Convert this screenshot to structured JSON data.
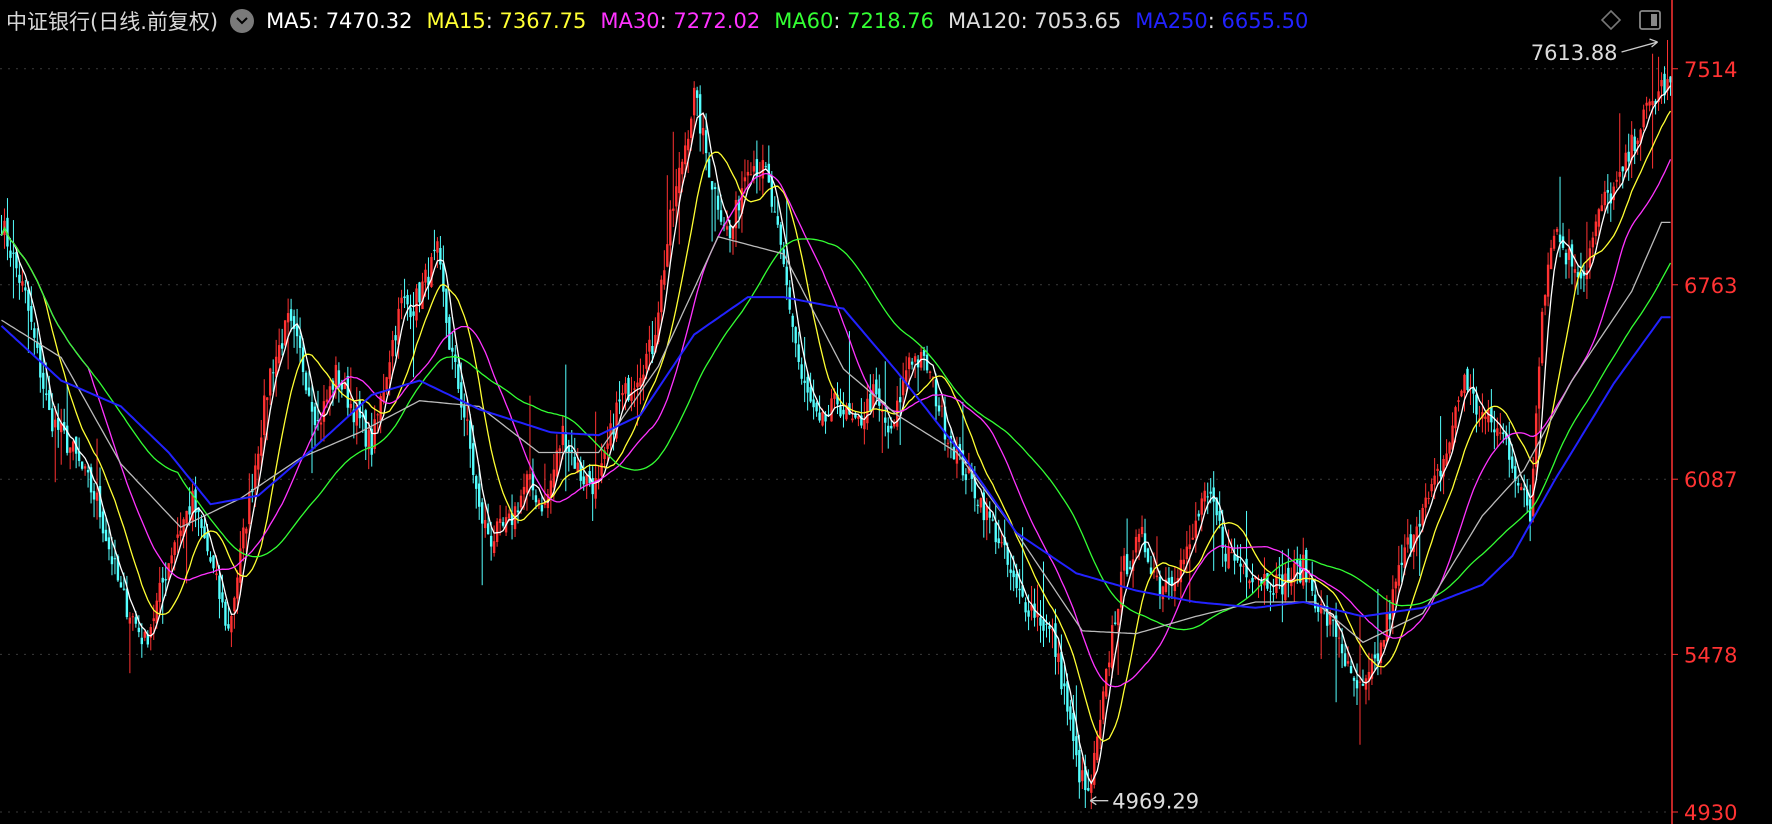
{
  "header": {
    "title": "中证银行(日线.前复权)",
    "dropdown_icon": "chevron-down-icon",
    "indicators": [
      {
        "label": "MA5",
        "value": "7470.32",
        "color": "#ffffff"
      },
      {
        "label": "MA15",
        "value": "7367.75",
        "color": "#ffff33"
      },
      {
        "label": "MA30",
        "value": "7272.02",
        "color": "#ff33ff"
      },
      {
        "label": "MA60",
        "value": "7218.76",
        "color": "#33ff33"
      },
      {
        "label": "MA120",
        "value": "7053.65",
        "color": "#dddddd"
      },
      {
        "label": "MA250",
        "value": "6655.50",
        "color": "#2222ff"
      }
    ],
    "icons": [
      "diamond-icon",
      "panel-toggle-icon"
    ]
  },
  "chart_data": {
    "type": "candlestick",
    "y_axis": {
      "ticks": [
        "7514",
        "6763",
        "6087",
        "5478",
        "4930"
      ],
      "ylim": [
        4930,
        7614
      ],
      "side": "right",
      "color": "#ff3333"
    },
    "grid": true,
    "annotations": [
      {
        "text": "7613.88",
        "kind": "high"
      },
      {
        "text": "4969.29",
        "kind": "low"
      }
    ],
    "close_path": [
      [
        0,
        6980
      ],
      [
        8,
        6720
      ],
      [
        16,
        6310
      ],
      [
        24,
        6180
      ],
      [
        32,
        6010
      ],
      [
        40,
        5690
      ],
      [
        48,
        5520
      ],
      [
        52,
        5650
      ],
      [
        58,
        5880
      ],
      [
        64,
        6010
      ],
      [
        70,
        5800
      ],
      [
        76,
        5560
      ],
      [
        84,
        6080
      ],
      [
        90,
        6460
      ],
      [
        96,
        6630
      ],
      [
        100,
        6520
      ],
      [
        106,
        6280
      ],
      [
        112,
        6450
      ],
      [
        118,
        6330
      ],
      [
        124,
        6200
      ],
      [
        130,
        6520
      ],
      [
        134,
        6700
      ],
      [
        138,
        6690
      ],
      [
        146,
        6870
      ],
      [
        150,
        6560
      ],
      [
        156,
        6260
      ],
      [
        160,
        5970
      ],
      [
        164,
        5880
      ],
      [
        170,
        5930
      ],
      [
        176,
        6080
      ],
      [
        182,
        5990
      ],
      [
        188,
        6250
      ],
      [
        194,
        6100
      ],
      [
        200,
        6060
      ],
      [
        206,
        6330
      ],
      [
        212,
        6440
      ],
      [
        218,
        6550
      ],
      [
        224,
        6980
      ],
      [
        232,
        7420
      ],
      [
        238,
        7120
      ],
      [
        244,
        6920
      ],
      [
        250,
        7200
      ],
      [
        256,
        7150
      ],
      [
        262,
        6820
      ],
      [
        268,
        6430
      ],
      [
        274,
        6260
      ],
      [
        280,
        6360
      ],
      [
        286,
        6260
      ],
      [
        292,
        6380
      ],
      [
        298,
        6230
      ],
      [
        304,
        6520
      ],
      [
        310,
        6480
      ],
      [
        316,
        6270
      ],
      [
        322,
        6130
      ],
      [
        328,
        6010
      ],
      [
        334,
        5880
      ],
      [
        340,
        5690
      ],
      [
        346,
        5630
      ],
      [
        352,
        5540
      ],
      [
        356,
        5350
      ],
      [
        360,
        5100
      ],
      [
        364,
        4975
      ],
      [
        368,
        5230
      ],
      [
        372,
        5560
      ],
      [
        376,
        5780
      ],
      [
        382,
        5880
      ],
      [
        388,
        5720
      ],
      [
        394,
        5780
      ],
      [
        398,
        5840
      ],
      [
        402,
        6010
      ],
      [
        406,
        5990
      ],
      [
        410,
        5840
      ],
      [
        414,
        5800
      ],
      [
        420,
        5760
      ],
      [
        428,
        5720
      ],
      [
        436,
        5780
      ],
      [
        442,
        5630
      ],
      [
        448,
        5540
      ],
      [
        452,
        5380
      ],
      [
        456,
        5340
      ],
      [
        462,
        5500
      ],
      [
        468,
        5760
      ],
      [
        474,
        5950
      ],
      [
        478,
        6010
      ],
      [
        484,
        6180
      ],
      [
        490,
        6450
      ],
      [
        494,
        6330
      ],
      [
        498,
        6290
      ],
      [
        504,
        6220
      ],
      [
        508,
        6080
      ],
      [
        512,
        5950
      ],
      [
        516,
        6700
      ],
      [
        520,
        6970
      ],
      [
        524,
        6870
      ],
      [
        530,
        6800
      ],
      [
        536,
        7040
      ],
      [
        542,
        7120
      ],
      [
        548,
        7300
      ],
      [
        552,
        7380
      ],
      [
        556,
        7450
      ]
    ],
    "series": [
      {
        "name": "MA5",
        "color": "#ffffff",
        "period": 5
      },
      {
        "name": "MA15",
        "color": "#ffff33",
        "period": 15
      },
      {
        "name": "MA30",
        "color": "#ff33ff",
        "period": 30
      },
      {
        "name": "MA60",
        "color": "#33ff33",
        "period": 60
      },
      {
        "name": "MA120",
        "color": "#bbbbbb",
        "period": 120
      },
      {
        "name": "MA250",
        "color": "#2222ff",
        "period": 250
      }
    ],
    "ma250_path": [
      [
        0,
        6620
      ],
      [
        20,
        6430
      ],
      [
        40,
        6340
      ],
      [
        56,
        6180
      ],
      [
        70,
        6000
      ],
      [
        86,
        6030
      ],
      [
        104,
        6190
      ],
      [
        124,
        6380
      ],
      [
        140,
        6430
      ],
      [
        160,
        6330
      ],
      [
        184,
        6250
      ],
      [
        200,
        6240
      ],
      [
        214,
        6310
      ],
      [
        232,
        6590
      ],
      [
        250,
        6720
      ],
      [
        262,
        6720
      ],
      [
        282,
        6680
      ],
      [
        300,
        6460
      ],
      [
        322,
        6170
      ],
      [
        340,
        5900
      ],
      [
        360,
        5760
      ],
      [
        380,
        5700
      ],
      [
        400,
        5660
      ],
      [
        420,
        5640
      ],
      [
        436,
        5660
      ],
      [
        456,
        5610
      ],
      [
        476,
        5640
      ],
      [
        496,
        5720
      ],
      [
        506,
        5820
      ],
      [
        520,
        6080
      ],
      [
        540,
        6420
      ],
      [
        556,
        6650
      ]
    ],
    "ma120_path": [
      [
        0,
        6640
      ],
      [
        20,
        6510
      ],
      [
        40,
        6140
      ],
      [
        60,
        5920
      ],
      [
        80,
        6020
      ],
      [
        100,
        6160
      ],
      [
        120,
        6250
      ],
      [
        140,
        6360
      ],
      [
        160,
        6340
      ],
      [
        180,
        6180
      ],
      [
        200,
        6180
      ],
      [
        220,
        6480
      ],
      [
        240,
        6930
      ],
      [
        262,
        6870
      ],
      [
        282,
        6470
      ],
      [
        300,
        6310
      ],
      [
        320,
        6180
      ],
      [
        340,
        5900
      ],
      [
        362,
        5560
      ],
      [
        380,
        5550
      ],
      [
        400,
        5610
      ],
      [
        420,
        5660
      ],
      [
        440,
        5660
      ],
      [
        456,
        5520
      ],
      [
        476,
        5620
      ],
      [
        496,
        5960
      ],
      [
        510,
        6120
      ],
      [
        526,
        6430
      ],
      [
        546,
        6740
      ],
      [
        556,
        6980
      ]
    ]
  }
}
